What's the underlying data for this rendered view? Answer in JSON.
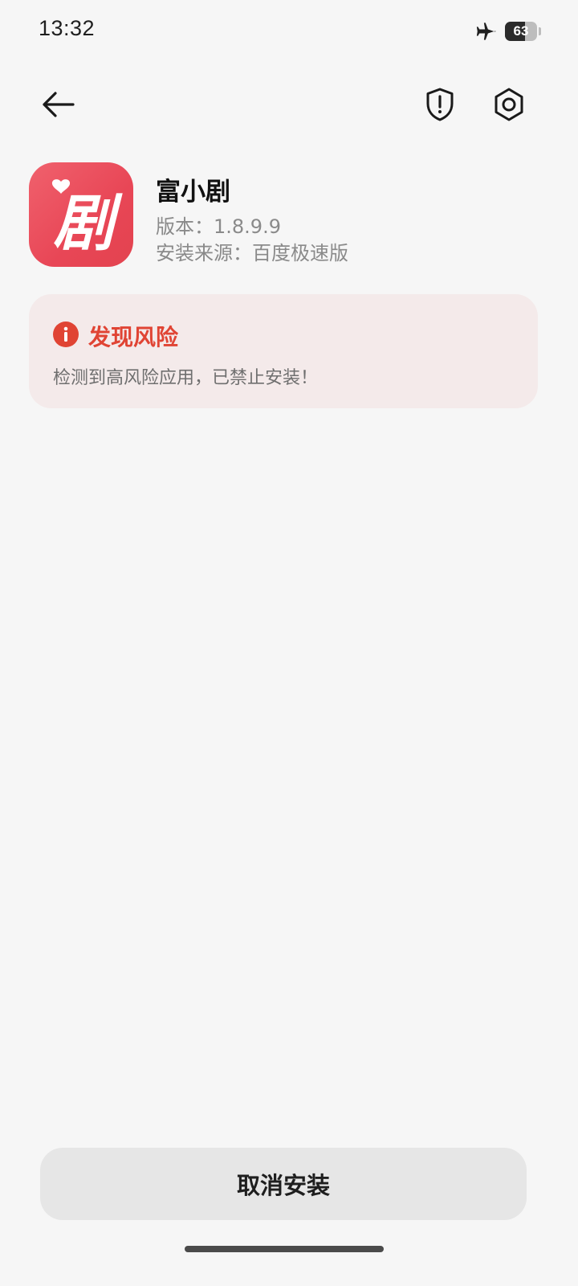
{
  "status_bar": {
    "time": "13:32",
    "airplane_icon": "airplane-icon",
    "battery_level": "63",
    "battery_fraction": 0.63
  },
  "nav": {
    "back_icon": "arrow-left-icon",
    "shield_icon": "shield-alert-icon",
    "settings_icon": "settings-gear-icon"
  },
  "app": {
    "icon_glyph": "剧",
    "name": "富小剧",
    "version": "版本：1.8.9.9",
    "source": "安装来源：百度极速版",
    "icon_colors": [
      "#f0616d",
      "#e3434f"
    ]
  },
  "risk": {
    "title": "发现风险",
    "description": "检测到高风险应用，已禁止安装！",
    "accent_color": "#e04434",
    "background_color": "#f4eaea"
  },
  "actions": {
    "cancel_label": "取消安装"
  }
}
